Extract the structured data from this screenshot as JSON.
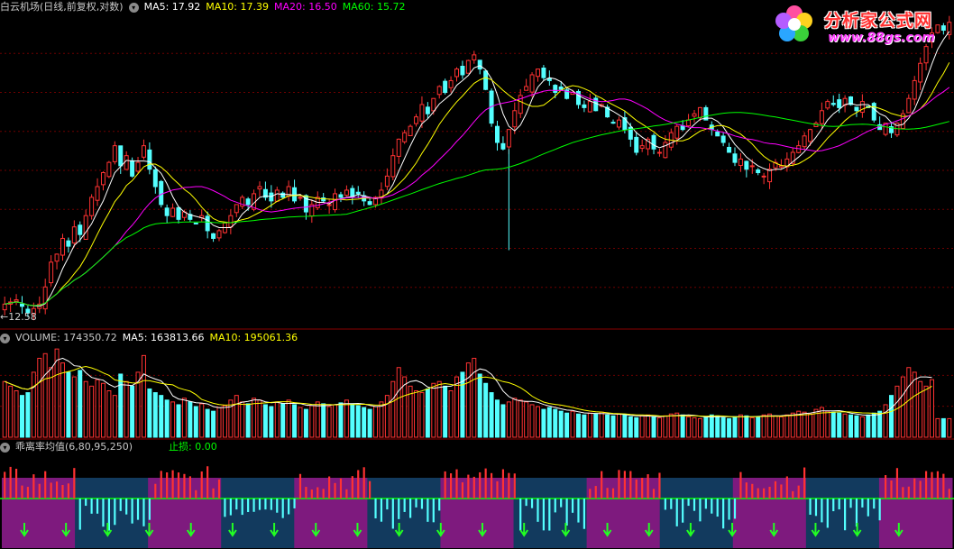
{
  "colors": {
    "up": "#ff3232",
    "down": "#54ffff",
    "ma5": "#ffffff",
    "ma10": "#ffff00",
    "ma20": "#ff00ff",
    "ma60": "#00ff00",
    "grid": "#6e0000",
    "label": "#c8c8c8",
    "bias_bg_purple": "#7e1a7e",
    "bias_bg_blue": "#123a5e",
    "stoploss": "#00ff00"
  },
  "price_panel": {
    "name": "白云机场(日线,前复权,对数)",
    "ma5": "MA5: 17.92",
    "ma10": "MA10: 17.39",
    "ma20": "MA20: 16.50",
    "ma60": "MA60: 15.72",
    "low_marker": "←12.58"
  },
  "volume_panel": {
    "volume": "VOLUME: 174350.72",
    "ma5": "MA5: 163813.66",
    "ma10": "MA10: 195061.36"
  },
  "bias_panel": {
    "name": "乖离率均值(6,80,95,250)",
    "stoploss": "止损: 0.00"
  },
  "watermark": {
    "name": "分析家公式网",
    "url": "www.88gs.com"
  },
  "chart_data": {
    "type": "candlestick",
    "series_names": [
      "MA5",
      "MA10",
      "MA20",
      "MA60",
      "VOLUME"
    ],
    "price_range": [
      12.4,
      21.6
    ],
    "lowest_label": 12.58,
    "closes": [
      12.9,
      12.95,
      13.0,
      12.85,
      12.7,
      12.8,
      12.9,
      13.3,
      13.9,
      14.1,
      14.5,
      14.3,
      14.8,
      14.6,
      15.1,
      15.6,
      15.9,
      16.3,
      16.6,
      17.1,
      16.5,
      16.8,
      16.2,
      16.6,
      17.1,
      16.4,
      15.9,
      15.4,
      15.1,
      15.3,
      15.0,
      15.2,
      15.0,
      14.9,
      15.1,
      14.7,
      14.5,
      14.7,
      14.9,
      15.1,
      15.4,
      15.6,
      15.4,
      15.7,
      15.9,
      15.6,
      15.5,
      15.8,
      15.6,
      15.9,
      15.5,
      15.6,
      15.2,
      15.4,
      15.6,
      15.5,
      15.4,
      15.7,
      15.6,
      15.8,
      15.6,
      15.7,
      15.5,
      15.4,
      15.6,
      15.8,
      16.2,
      16.8,
      17.3,
      17.5,
      17.7,
      18.0,
      18.4,
      18.1,
      18.6,
      19.0,
      18.8,
      19.2,
      19.6,
      19.4,
      19.9,
      20.1,
      19.6,
      18.9,
      17.8,
      17.2,
      17.0,
      17.6,
      18.2,
      18.7,
      19.0,
      19.4,
      19.6,
      19.3,
      19.2,
      18.8,
      18.9,
      18.6,
      18.8,
      18.4,
      18.3,
      18.5,
      18.2,
      18.4,
      18.0,
      17.8,
      17.9,
      17.6,
      17.3,
      16.9,
      17.1,
      17.3,
      17.0,
      16.9,
      17.2,
      17.5,
      17.7,
      17.6,
      17.9,
      18.1,
      18.3,
      17.9,
      17.6,
      17.4,
      17.2,
      16.9,
      16.6,
      16.7,
      16.4,
      16.5,
      16.3,
      16.2,
      16.4,
      16.6,
      16.5,
      16.7,
      16.9,
      17.1,
      17.4,
      17.6,
      17.8,
      18.2,
      18.5,
      18.4,
      18.3,
      18.6,
      18.4,
      18.2,
      18.5,
      18.3,
      17.9,
      17.6,
      17.8,
      17.5,
      17.8,
      18.1,
      18.6,
      19.2,
      19.8,
      20.4,
      20.9,
      21.2,
      21.0,
      21.3
    ],
    "volumes": [
      60,
      55,
      50,
      45,
      48,
      70,
      85,
      90,
      75,
      95,
      80,
      70,
      65,
      72,
      60,
      55,
      62,
      58,
      50,
      45,
      68,
      60,
      55,
      70,
      88,
      52,
      48,
      45,
      40,
      38,
      35,
      42,
      38,
      33,
      36,
      30,
      28,
      32,
      34,
      40,
      45,
      38,
      36,
      42,
      40,
      35,
      33,
      38,
      36,
      40,
      35,
      32,
      30,
      34,
      38,
      36,
      33,
      35,
      37,
      40,
      36,
      34,
      32,
      30,
      33,
      38,
      45,
      60,
      75,
      65,
      55,
      50,
      48,
      52,
      58,
      60,
      55,
      50,
      65,
      70,
      80,
      85,
      68,
      58,
      48,
      40,
      35,
      38,
      42,
      40,
      38,
      35,
      33,
      30,
      32,
      30,
      28,
      26,
      28,
      25,
      24,
      26,
      25,
      27,
      24,
      23,
      25,
      24,
      22,
      21,
      23,
      24,
      22,
      21,
      23,
      25,
      26,
      24,
      22,
      21,
      20,
      22,
      24,
      23,
      21,
      20,
      22,
      24,
      23,
      21,
      22,
      24,
      25,
      23,
      22,
      24,
      26,
      28,
      27,
      25,
      30,
      32,
      28,
      27,
      26,
      25,
      24,
      23,
      22,
      24,
      26,
      28,
      35,
      45,
      55,
      65,
      75,
      70,
      60,
      55,
      62
    ],
    "bias_regions": [
      "purple",
      "blue",
      "purple",
      "blue",
      "purple",
      "blue",
      "purple",
      "blue",
      "purple",
      "blue",
      "purple",
      "blue",
      "purple"
    ],
    "arrow_count": 22,
    "stoploss_value": 0.0
  }
}
